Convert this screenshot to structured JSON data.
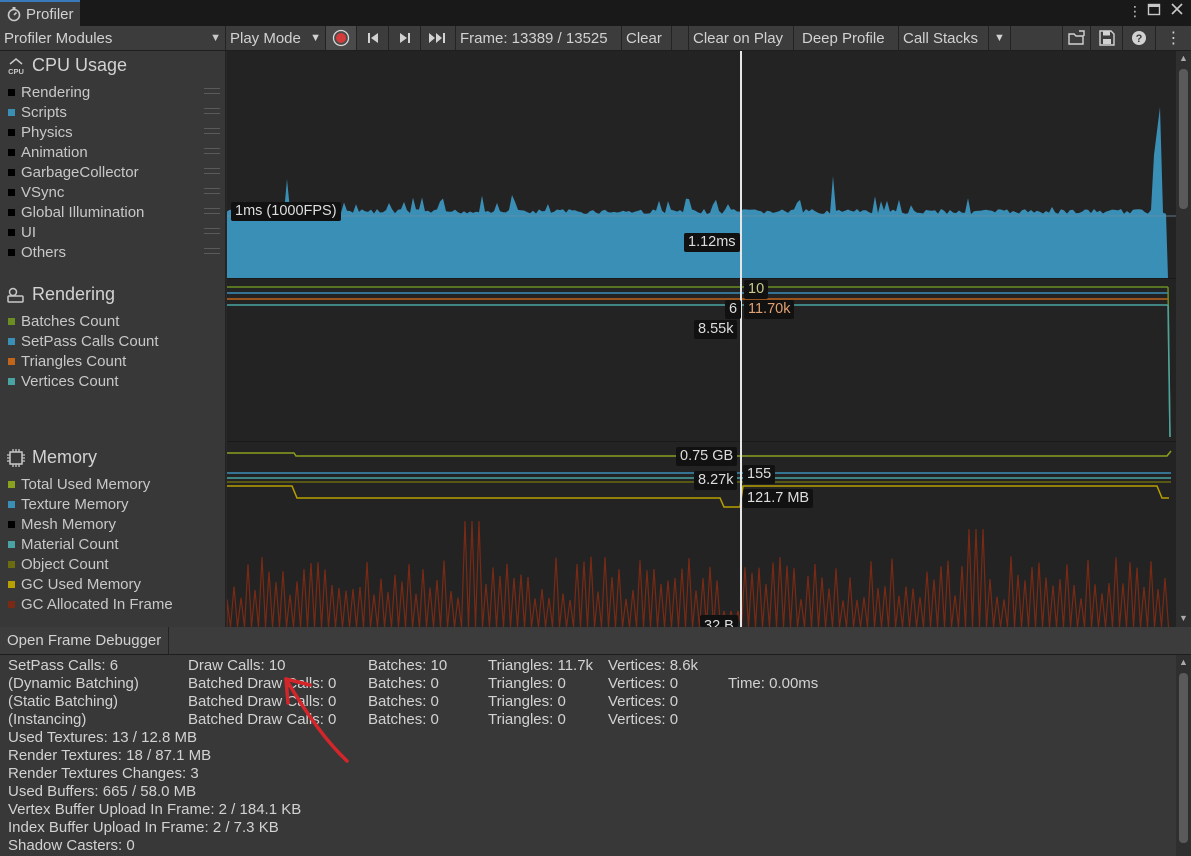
{
  "window": {
    "tab_title": "Profiler",
    "menu_icon": "kebab-icon",
    "maximize_icon": "maximize-icon",
    "close_icon": "close-icon"
  },
  "toolbar": {
    "modules_label": "Profiler Modules",
    "play_mode_label": "Play Mode",
    "frame_label": "Frame: 13389 / 13525",
    "clear_label": "Clear",
    "clear_on_play_label": "Clear on Play",
    "deep_profile_label": "Deep Profile",
    "call_stacks_label": "Call Stacks"
  },
  "modules": {
    "cpu": {
      "title": "CPU Usage",
      "items": [
        {
          "label": "Rendering",
          "color": "#000000"
        },
        {
          "label": "Scripts",
          "color": "#3a8fb7"
        },
        {
          "label": "Physics",
          "color": "#000000"
        },
        {
          "label": "Animation",
          "color": "#000000"
        },
        {
          "label": "GarbageCollector",
          "color": "#000000"
        },
        {
          "label": "VSync",
          "color": "#000000"
        },
        {
          "label": "Global Illumination",
          "color": "#000000"
        },
        {
          "label": "UI",
          "color": "#000000"
        },
        {
          "label": "Others",
          "color": "#000000"
        }
      ],
      "chart_labels": {
        "fps_line": "1ms (1000FPS)",
        "selected_value": "1.12ms"
      }
    },
    "rendering": {
      "title": "Rendering",
      "items": [
        {
          "label": "Batches Count",
          "color": "#6b8e23"
        },
        {
          "label": "SetPass Calls Count",
          "color": "#3a8fb7"
        },
        {
          "label": "Triangles Count",
          "color": "#c0651a"
        },
        {
          "label": "Vertices Count",
          "color": "#4aa3a3"
        }
      ],
      "chart_labels": {
        "batches": "10",
        "setpass": "6",
        "triangles": "11.70k",
        "vertices": "8.55k"
      }
    },
    "memory": {
      "title": "Memory",
      "items": [
        {
          "label": "Total Used Memory",
          "color": "#8aa01f"
        },
        {
          "label": "Texture Memory",
          "color": "#3a8fb7"
        },
        {
          "label": "Mesh Memory",
          "color": "#000000"
        },
        {
          "label": "Material Count",
          "color": "#4aa3a3"
        },
        {
          "label": "Object Count",
          "color": "#6b6b10"
        },
        {
          "label": "GC Used Memory",
          "color": "#b8a000"
        },
        {
          "label": "GC Allocated In Frame",
          "color": "#7a2a14"
        }
      ],
      "chart_labels": {
        "total_used": "0.75 GB",
        "material": "155",
        "object": "8.27k",
        "gc_used": "121.7 MB",
        "gc_alloc": "32 B"
      }
    }
  },
  "bottom": {
    "open_frame_debugger_label": "Open Frame Debugger",
    "stats": {
      "setpass": "SetPass Calls: 6",
      "draw_calls": "Draw Calls: 10",
      "batches": "Batches: 10",
      "triangles": "Triangles: 11.7k",
      "vertices": "Vertices: 8.6k",
      "dyn_label": "(Dynamic Batching)",
      "dyn_draw": "Batched Draw Calls: 0",
      "dyn_batches": "Batches: 0",
      "dyn_tris": "Triangles: 0",
      "dyn_verts": "Vertices: 0",
      "time": "Time: 0.00ms",
      "static_label": "(Static Batching)",
      "static_draw": "Batched Draw Calls: 0",
      "static_batches": "Batches: 0",
      "static_tris": "Triangles: 0",
      "static_verts": "Vertices: 0",
      "inst_label": "(Instancing)",
      "inst_draw": "Batched Draw Calls: 0",
      "inst_batches": "Batches: 0",
      "inst_tris": "Triangles: 0",
      "inst_verts": "Vertices: 0",
      "used_textures": "Used Textures: 13 / 12.8 MB",
      "render_textures": "Render Textures: 18 / 87.1 MB",
      "rt_changes": "Render Textures Changes: 3",
      "used_buffers": "Used Buffers: 665 / 58.0 MB",
      "vb_upload": "Vertex Buffer Upload In Frame: 2 / 184.1 KB",
      "ib_upload": "Index Buffer Upload In Frame: 2 / 7.3 KB",
      "shadow_casters": "Shadow Casters: 0"
    }
  },
  "colors": {
    "accent": "#3a79bb",
    "annotation_arrow": "#d4262a",
    "cpu_fill": "#3a8fb7"
  }
}
